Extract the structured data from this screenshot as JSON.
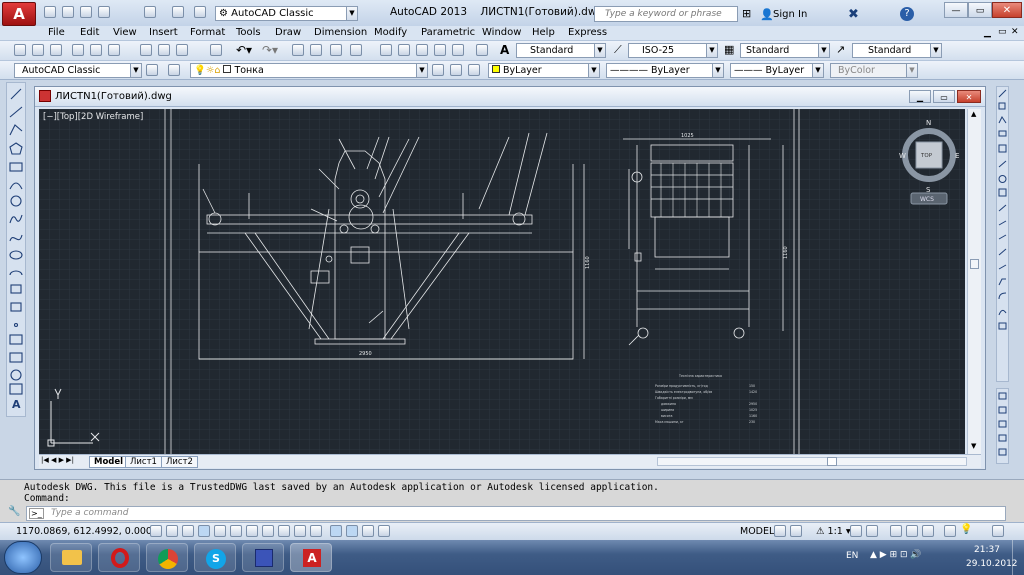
{
  "app": {
    "title": "AutoCAD 2013",
    "document": "ЛИСТN1(Готовий).dwg",
    "workspace": "AutoCAD Classic",
    "search_placeholder": "Type a keyword or phrase",
    "sign_in": "Sign In"
  },
  "menu": [
    "File",
    "Edit",
    "View",
    "Insert",
    "Format",
    "Tools",
    "Draw",
    "Dimension",
    "Modify",
    "Parametric",
    "Window",
    "Help",
    "Express"
  ],
  "styles": {
    "text_style": "Standard",
    "dim_style": "ISO-25",
    "table_style": "Standard",
    "mleader_style": "Standard"
  },
  "layers": {
    "workspace": "AutoCAD Classic",
    "current_layer": "Тонка",
    "color": "ByLayer",
    "linetype": "ByLayer",
    "lineweight": "ByLayer",
    "plotstyle": "ByColor"
  },
  "drawing_window": {
    "title": "ЛИСТN1(Готовий).dwg",
    "viewport_label": "[−][Top][2D Wireframe]",
    "viewcube": {
      "top": "TOP",
      "n": "N",
      "s": "S",
      "e": "E",
      "w": "W",
      "wcs": "WCS"
    }
  },
  "layout_tabs": [
    "Model",
    "Лист1",
    "Лист2"
  ],
  "command": {
    "history": "Autodesk DWG.  This file is a TrustedDWG last saved by an Autodesk application or Autodesk licensed application.",
    "prompt": "Command:",
    "input_placeholder": "Type a command"
  },
  "status": {
    "coords": "1170.0869, 612.4992, 0.0000",
    "model": "MODEL",
    "scale": "1:1"
  },
  "drawing_text": {
    "dim_bottom": "2950",
    "dim_right_top": "1160",
    "dim_side": "1025",
    "table_title": "Технічна характеристика",
    "table_rows": [
      [
        "Розміри продуктивність, кг/год",
        "150"
      ],
      [
        "Швидкість електродвигуна, об/хв",
        "1420"
      ],
      [
        "Габаритні розміри, мм",
        ""
      ],
      [
        "довжина",
        "2950"
      ],
      [
        "ширина",
        "1025"
      ],
      [
        "висота",
        "1160"
      ],
      [
        "Маса машини, кг",
        "230"
      ]
    ]
  },
  "taskbar": {
    "lang": "EN",
    "time": "21:37",
    "date": "29.10.2012"
  },
  "colors": {
    "canvas": "#212830",
    "grid": "#2d3640",
    "lines": "#e6e8ea"
  }
}
